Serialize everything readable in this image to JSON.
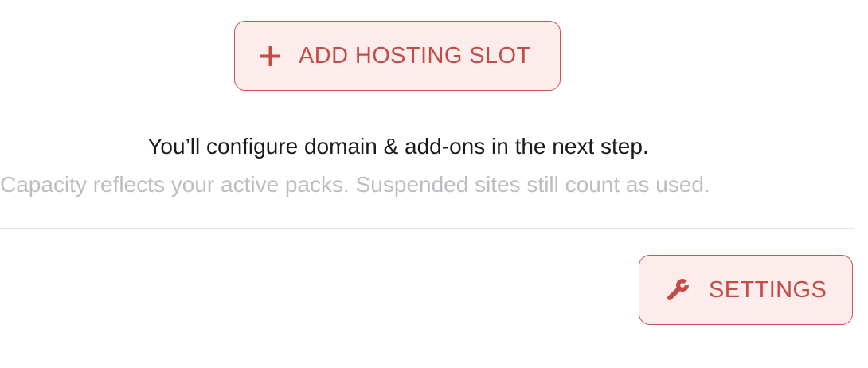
{
  "add_slot_button": {
    "label": "ADD HOSTING SLOT",
    "icon": "plus-icon"
  },
  "notes": {
    "primary": "You’ll configure domain & add-ons in the next step.",
    "secondary": "Capacity reflects your active packs. Suspended sites still count as used."
  },
  "settings_button": {
    "label": "SETTINGS",
    "icon": "wrench-icon"
  },
  "colors": {
    "accent": "#c24d47",
    "button_bg": "#fcecec",
    "primary_text": "#1a1a1a",
    "muted_text": "#bdbdc1",
    "divider": "#e4e4e6"
  }
}
